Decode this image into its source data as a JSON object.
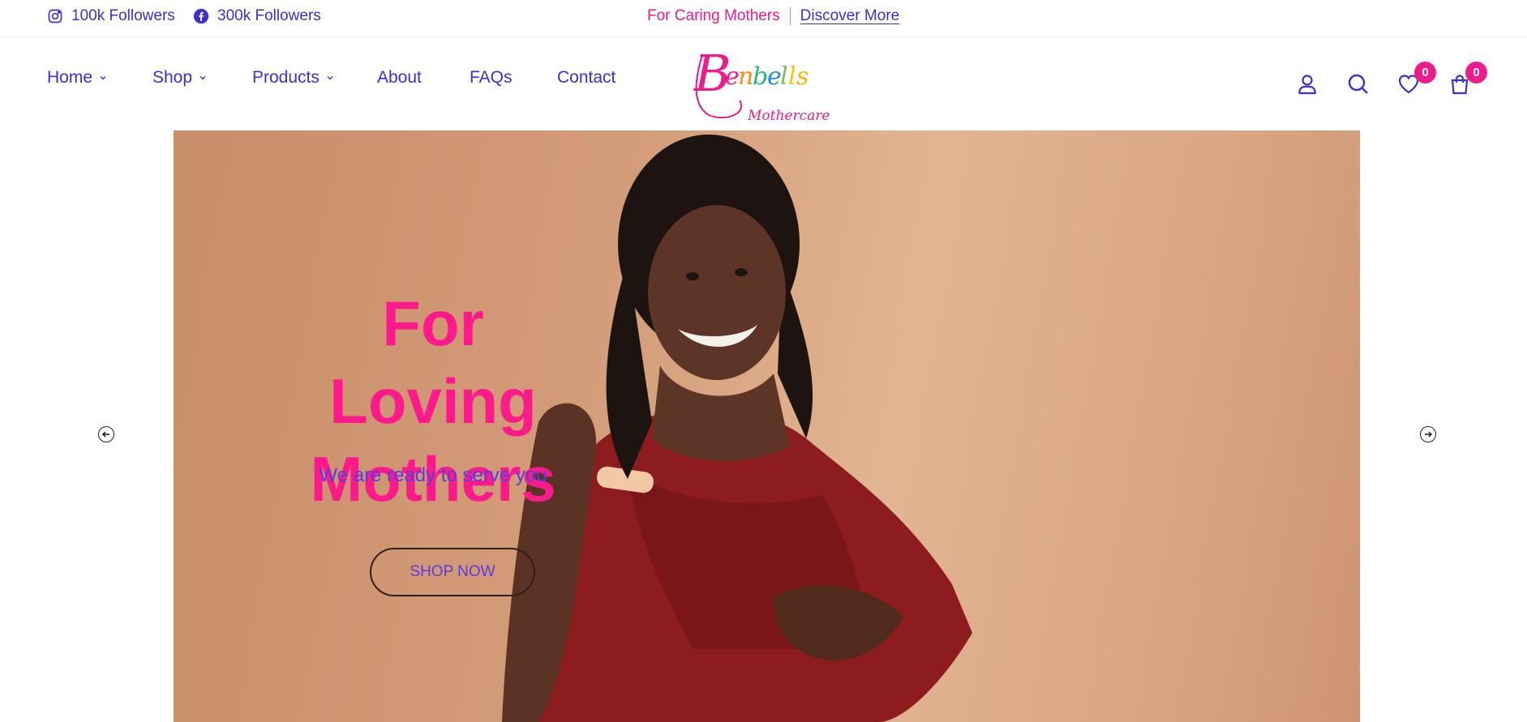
{
  "topbar": {
    "instagram": {
      "icon": "instagram-icon",
      "label": "100k Followers"
    },
    "facebook": {
      "icon": "facebook-icon",
      "label": "300k Followers"
    },
    "promo_tag": "For Caring Mothers",
    "promo_link": "Discover More"
  },
  "nav": {
    "items": [
      {
        "label": "Home",
        "has_dropdown": true
      },
      {
        "label": "Shop",
        "has_dropdown": true
      },
      {
        "label": "Products",
        "has_dropdown": true
      },
      {
        "label": "About",
        "has_dropdown": false
      },
      {
        "label": "FAQs",
        "has_dropdown": false
      },
      {
        "label": "Contact",
        "has_dropdown": false
      }
    ]
  },
  "logo": {
    "brand": "Benbells",
    "tagline": "Mothercare"
  },
  "header_icons": {
    "account": "user-icon",
    "search": "search-icon",
    "wishlist": {
      "icon": "heart-icon",
      "count": "0"
    },
    "cart": {
      "icon": "shopping-bag-icon",
      "count": "0"
    }
  },
  "hero": {
    "title_line1": "For Loving",
    "title_line2": "Mothers",
    "subtitle": "We are ready to serve you",
    "cta": "SHOP NOW"
  },
  "carousel": {
    "prev_icon": "arrow-left-icon",
    "next_icon": "arrow-right-icon"
  },
  "colors": {
    "primary": "#3d2fd6",
    "accent": "#ee1c8a",
    "hero_bg": "#d9a381"
  }
}
